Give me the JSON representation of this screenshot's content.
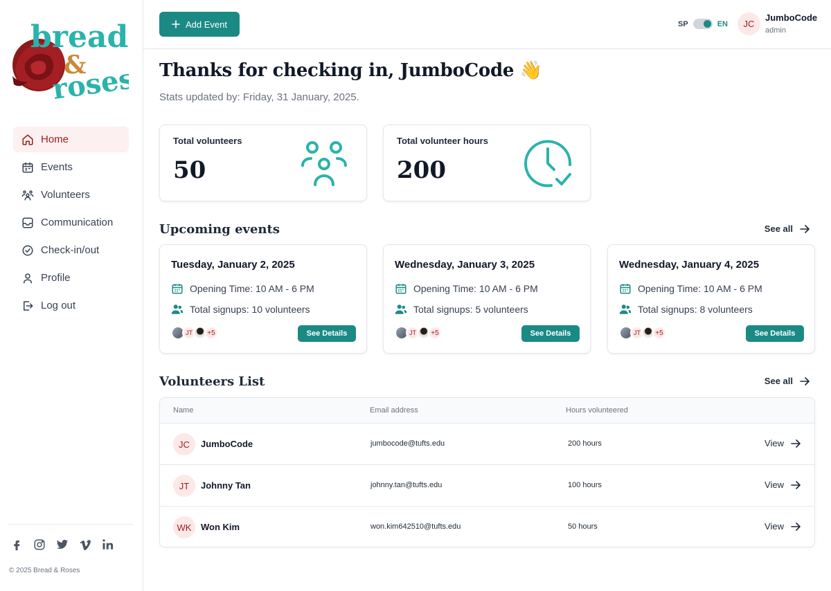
{
  "brand": {
    "logo_top": "bread",
    "logo_amp": "&",
    "logo_bottom": "roses"
  },
  "colors": {
    "accent": "#1b8a84",
    "brand_red": "#9b1c1c",
    "active_bg": "#fdf0f0",
    "icon_teal": "#2ab3ac"
  },
  "sidebar": {
    "items": [
      {
        "label": "Home",
        "icon": "home-icon",
        "active": true
      },
      {
        "label": "Events",
        "icon": "calendar-icon",
        "active": false
      },
      {
        "label": "Volunteers",
        "icon": "people-icon",
        "active": false
      },
      {
        "label": "Communication",
        "icon": "inbox-icon",
        "active": false
      },
      {
        "label": "Check-in/out",
        "icon": "check-circle-icon",
        "active": false
      },
      {
        "label": "Profile",
        "icon": "user-icon",
        "active": false
      },
      {
        "label": "Log out",
        "icon": "logout-icon",
        "active": false
      }
    ],
    "socials": [
      "facebook-icon",
      "instagram-icon",
      "twitter-icon",
      "vimeo-icon",
      "linkedin-icon"
    ],
    "copyright": "© 2025 Bread & Roses"
  },
  "topbar": {
    "add_event_label": "Add Event",
    "lang_sp": "SP",
    "lang_en": "EN",
    "user_initials": "JC",
    "user_name": "JumboCode",
    "user_role": "admin"
  },
  "main": {
    "greeting": "Thanks for checking in, JumboCode",
    "greeting_emoji": "👋",
    "updated": "Stats updated by: Friday, 31 January, 2025.",
    "stats": [
      {
        "label": "Total volunteers",
        "value": "50",
        "icon": "volunteers-icon"
      },
      {
        "label": "Total volunteer hours",
        "value": "200",
        "icon": "clock-check-icon"
      }
    ],
    "upcoming_title": "Upcoming events",
    "see_all": "See all",
    "events": [
      {
        "date": "Tuesday, January 2, 2025",
        "opening": "Opening Time: 10 AM - 6 PM",
        "signups": "Total signups: 10 volunteers",
        "avatar_initials": "JT",
        "more": "+5",
        "button": "See Details"
      },
      {
        "date": "Wednesday, January 3, 2025",
        "opening": "Opening Time: 10 AM - 6 PM",
        "signups": "Total signups: 5 volunteers",
        "avatar_initials": "JT",
        "more": "+5",
        "button": "See Details"
      },
      {
        "date": "Wednesday, January 4, 2025",
        "opening": "Opening Time: 10 AM - 6 PM",
        "signups": "Total signups: 8 volunteers",
        "avatar_initials": "JT",
        "more": "+5",
        "button": "See Details"
      }
    ],
    "volunteers_title": "Volunteers List",
    "table": {
      "headers": {
        "name": "Name",
        "email": "Email address",
        "hours": "Hours volunteered"
      },
      "rows": [
        {
          "initials": "JC",
          "name": "JumboCode",
          "email": "jumbocode@tufts.edu",
          "hours": "200 hours",
          "action": "View"
        },
        {
          "initials": "JT",
          "name": "Johnny Tan",
          "email": "johnny.tan@tufts.edu",
          "hours": "100 hours",
          "action": "View"
        },
        {
          "initials": "WK",
          "name": "Won Kim",
          "email": "won.kim642510@tufts.edu",
          "hours": "50 hours",
          "action": "View"
        }
      ]
    }
  }
}
